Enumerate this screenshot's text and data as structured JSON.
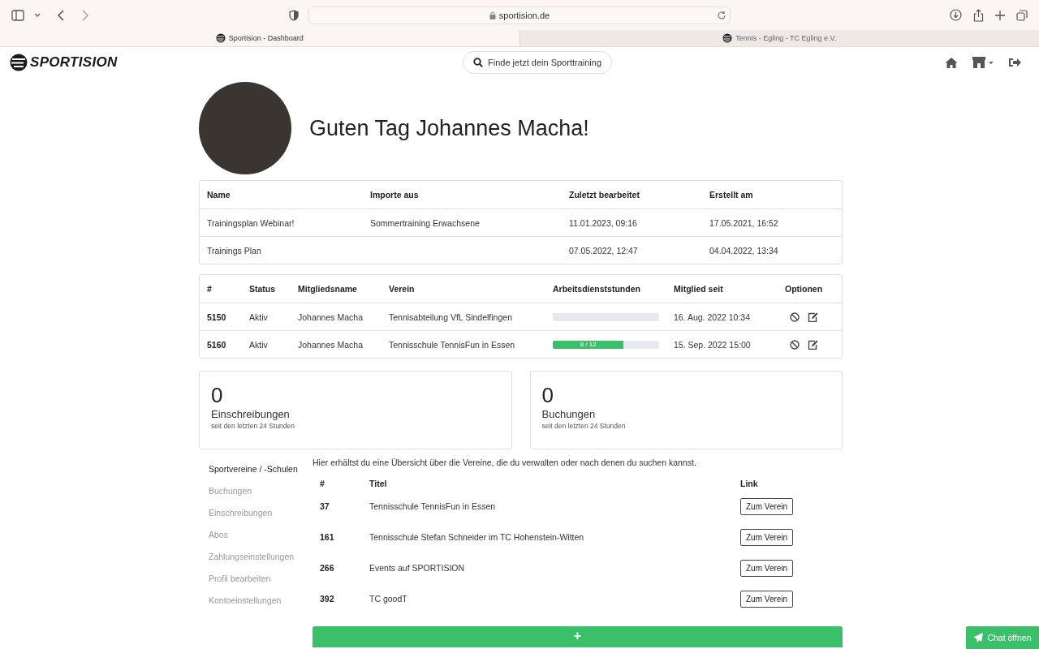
{
  "browser": {
    "address": "sportision.de",
    "tabs": [
      {
        "title": "Sportision - Dashboard",
        "selected": true
      },
      {
        "title": "Tennis - Egling - TC Egling e.V.",
        "selected": false
      }
    ]
  },
  "header": {
    "logo": "SPORTISION",
    "search": "Finde jetzt dein Sporttraining"
  },
  "profile": {
    "greeting": "Guten Tag Johannes Macha!"
  },
  "plans": {
    "columns": [
      "Name",
      "Importe aus",
      "Zuletzt bearbeitet",
      "Erstellt am"
    ],
    "rows": [
      {
        "name": "Trainingsplan Webinar!",
        "imported_from": "Sommertraining Erwachsene",
        "edited": "11.01.2023, 09:16",
        "created": "17.05.2021, 16:52"
      },
      {
        "name": "Trainings Plan",
        "edited": "07.05.2022, 12:47",
        "created": "04.04.2022, 13:34"
      }
    ]
  },
  "memberships": {
    "columns": [
      "#",
      "Status",
      "Mitgliedsname",
      "Verein",
      "Arbeitsdienststunden",
      "Mitglied seit",
      "Optionen"
    ],
    "rows": [
      {
        "id": "5150",
        "status": "Aktiv",
        "member": "Johannes Macha",
        "club": "Tennisabteilung VfL Sindelfingen",
        "hours": {
          "level": 0
        },
        "since": "16. Aug. 2022 10:34"
      },
      {
        "id": "5160",
        "status": "Aktiv",
        "member": "Johannes Macha",
        "club": "Tennisschule TennisFun in Essen",
        "hours": {
          "level": 0.667,
          "label": "8 / 12"
        },
        "since": "15. Sep. 2022 15:00"
      }
    ]
  },
  "stats": [
    {
      "count": "0",
      "label": "Einschreibungen",
      "note": "seit den letzten 24 Stunden"
    },
    {
      "count": "0",
      "label": "Buchungen",
      "note": "seit den letzten 24 Stunden"
    }
  ],
  "sidebar": {
    "items": [
      {
        "label": "Sportvereine / -Schulen",
        "selected": true
      },
      {
        "label": "Buchungen",
        "selected": false
      },
      {
        "label": "Einschreibungen",
        "selected": false
      },
      {
        "label": "Abos",
        "selected": false
      },
      {
        "label": "Zahlungseinstellungen",
        "selected": false
      },
      {
        "label": "Profil bearbeiten",
        "selected": false
      },
      {
        "label": "Kontoeinstellungen",
        "selected": false
      }
    ]
  },
  "clubs": {
    "intro": "Hier erhältst du eine Übersicht über die Vereine, die du verwalten oder nach denen du suchen kannst.",
    "columns": [
      "#",
      "Titel",
      "Link"
    ],
    "rows": [
      {
        "id": "37",
        "title": "Tennisschule TennisFun in Essen",
        "link": "Zum Verein"
      },
      {
        "id": "161",
        "title": "Tennisschule Stefan Schneider im TC Hohenstein-Witten",
        "link": "Zum Verein"
      },
      {
        "id": "266",
        "title": "Events auf SPORTISION",
        "link": "Zum Verein"
      },
      {
        "id": "392",
        "title": "TC goodT",
        "link": "Zum Verein"
      }
    ],
    "add_button": "+"
  },
  "chat_button": "Chat öffnen"
}
